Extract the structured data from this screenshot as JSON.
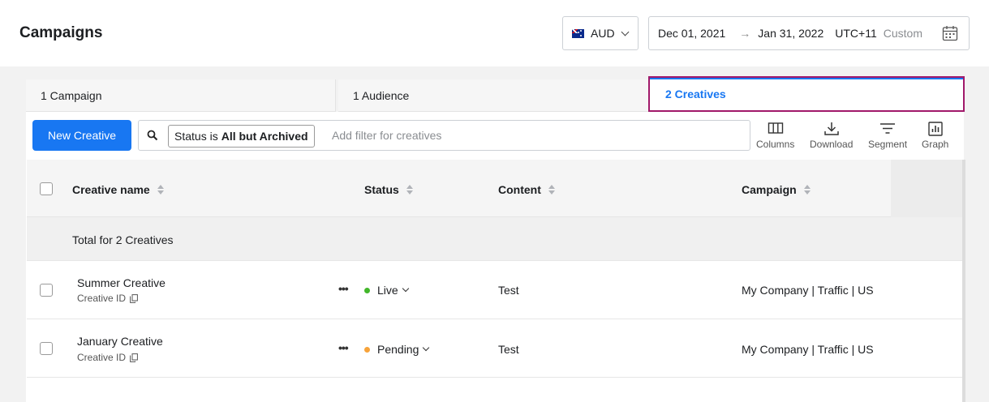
{
  "header": {
    "title": "Campaigns",
    "currency": "AUD",
    "date_start": "Dec 01, 2021",
    "date_arrow": "→",
    "date_end": "Jan 31, 2022",
    "timezone": "UTC+11",
    "range_mode": "Custom"
  },
  "tabs": [
    {
      "label": "1 Campaign"
    },
    {
      "label": "1 Audience"
    },
    {
      "label": "2 Creatives",
      "active": true
    }
  ],
  "toolbar": {
    "new_button": "New Creative",
    "filter_prefix": "Status is",
    "filter_value": "All but Archived",
    "filter_placeholder": "Add filter for creatives",
    "tools": [
      "Columns",
      "Download",
      "Segment",
      "Graph"
    ]
  },
  "table": {
    "columns": [
      "Creative name",
      "Status",
      "Content",
      "Campaign"
    ],
    "total_label": "Total for 2 Creatives",
    "rows": [
      {
        "name": "Summer Creative",
        "id_label": "Creative ID",
        "status": "Live",
        "status_color": "#42b72a",
        "content": "Test",
        "campaign": "My Company | Traffic | US"
      },
      {
        "name": "January Creative",
        "id_label": "Creative ID",
        "status": "Pending",
        "status_color": "#f7a33a",
        "content": "Test",
        "campaign": "My Company | Traffic | US"
      }
    ]
  },
  "colors": {
    "accent": "#1877f2",
    "highlight": "#a1196a"
  }
}
